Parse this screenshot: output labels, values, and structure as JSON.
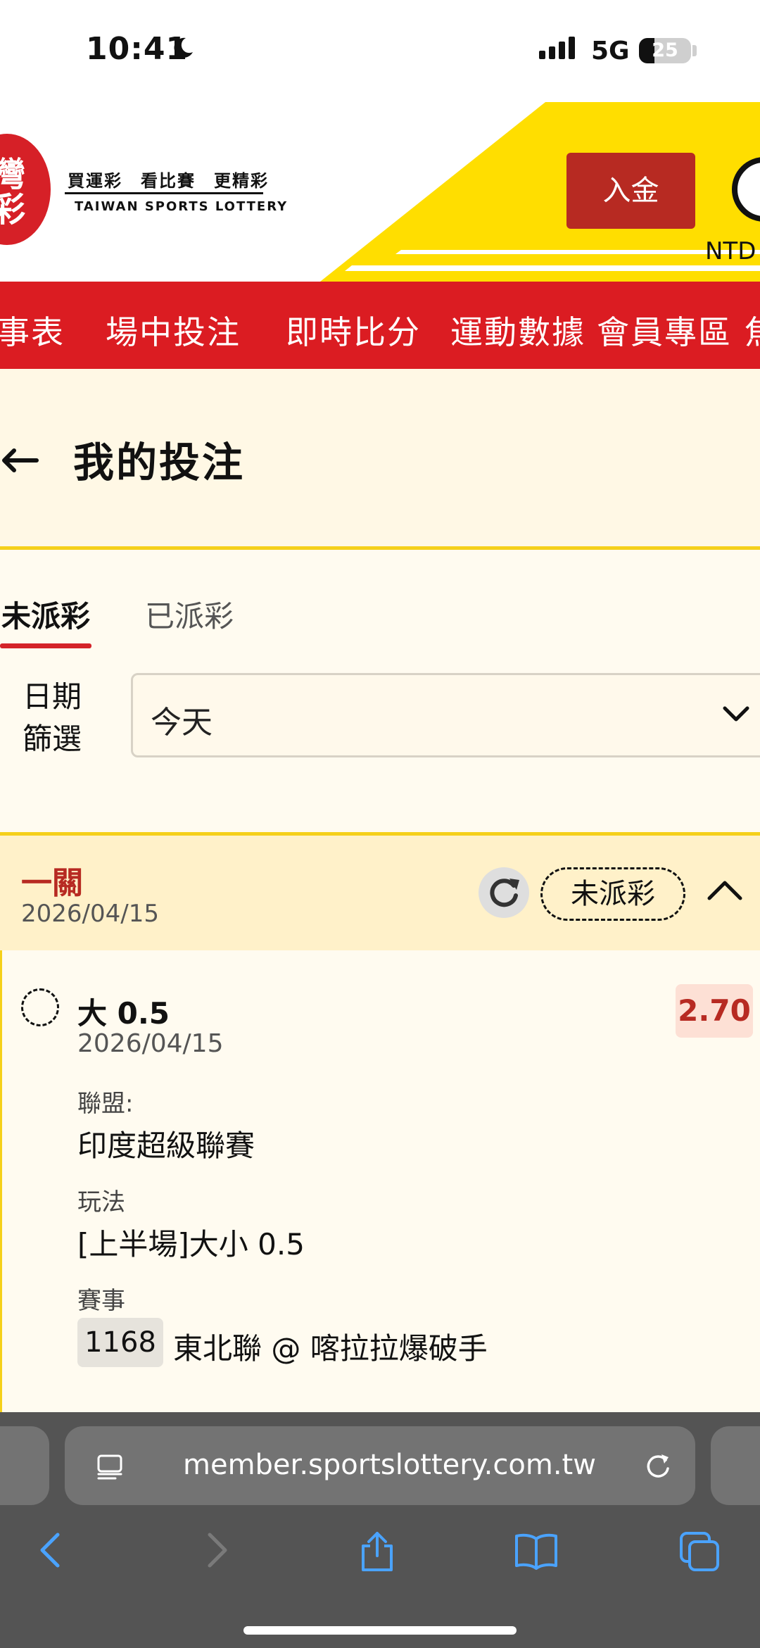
{
  "status_bar": {
    "time": "10:41",
    "network": "5G",
    "battery": "25"
  },
  "header": {
    "logo_text": "灣彩",
    "slogan": "買運彩　看比賽　更精彩",
    "brand_en": "TAIWAN SPORTS LOTTERY",
    "deposit_label": "入金",
    "currency": "NTD"
  },
  "nav": {
    "items": [
      "事表",
      "場中投注",
      "即時比分",
      "運動數據",
      "會員專區",
      "焦"
    ]
  },
  "page": {
    "title": "我的投注"
  },
  "tabs": {
    "unsettled": "未派彩",
    "settled": "已派彩"
  },
  "filter": {
    "label": "日期篩選",
    "label_line1": "日期",
    "label_line2": "篩選",
    "value": "今天"
  },
  "bet": {
    "type": "一關",
    "date": "2026/04/15",
    "status": "未派彩",
    "selection": "大 0.5",
    "odds": "2.70",
    "selection_date": "2026/04/15",
    "league_label": "聯盟:",
    "league": "印度超級聯賽",
    "market_label": "玩法",
    "market": "[上半場]大小 0.5",
    "match_label": "賽事",
    "match_id": "1168",
    "match_name": "東北聯 @ 喀拉拉爆破手"
  },
  "browser": {
    "url": "member.sportslottery.com.tw"
  },
  "colors": {
    "brand_red": "#db1c22",
    "accent_yellow": "#f5d01a",
    "odds_red": "#b72a22"
  }
}
